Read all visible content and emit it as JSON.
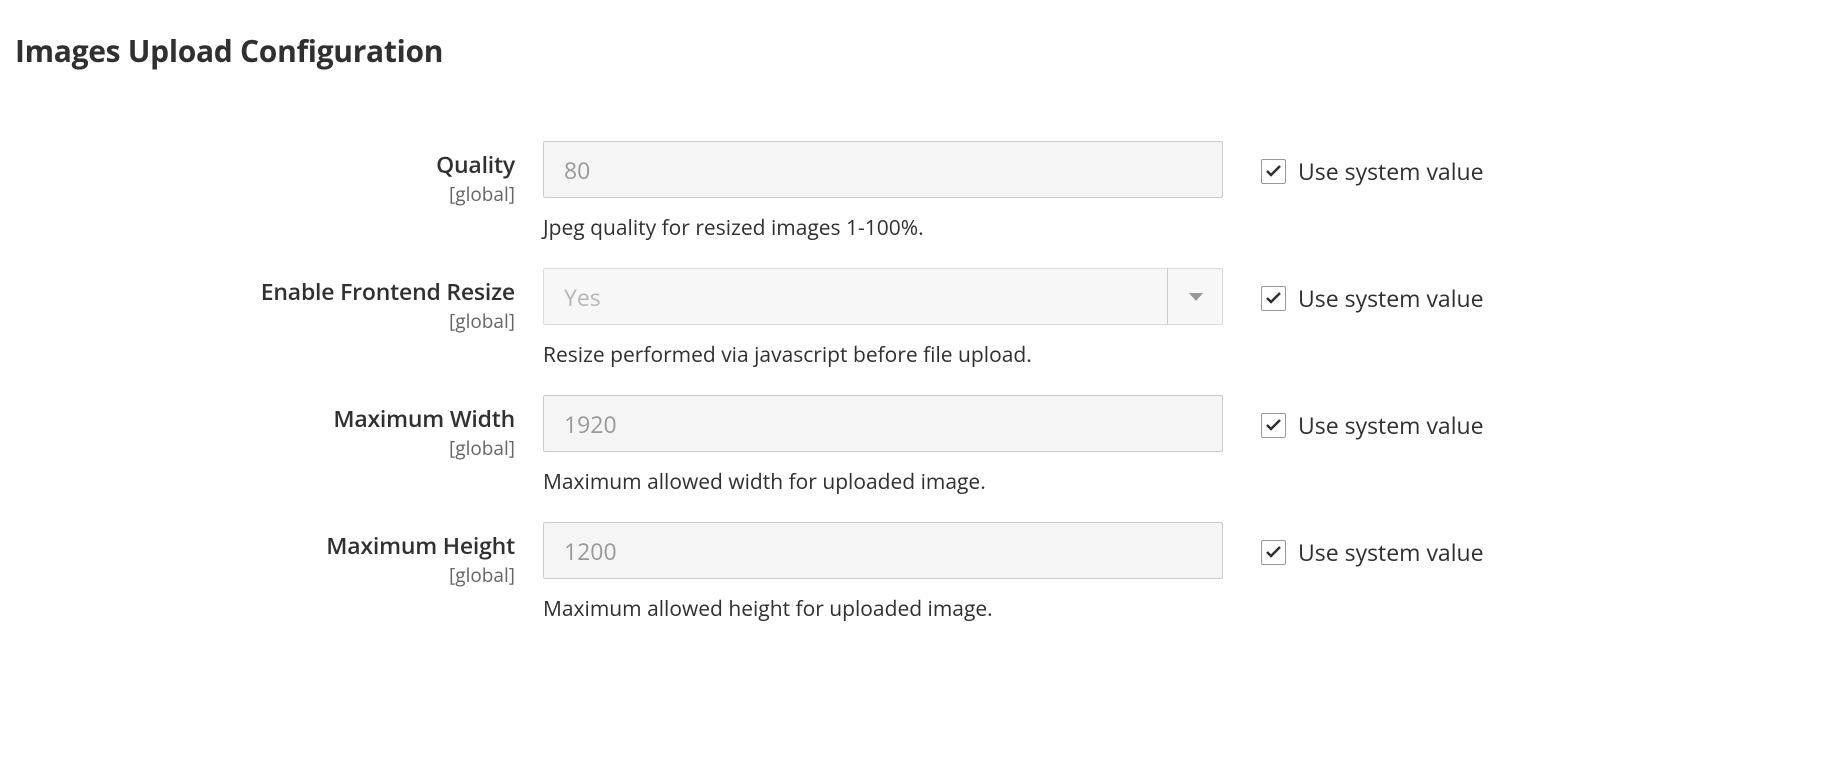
{
  "section": {
    "title": "Images Upload Configuration"
  },
  "common": {
    "scope_label": "[global]",
    "use_system_label": "Use system value"
  },
  "fields": {
    "quality": {
      "label": "Quality",
      "value": "80",
      "help": "Jpeg quality for resized images 1-100%.",
      "use_system": true
    },
    "frontend_resize": {
      "label": "Enable Frontend Resize",
      "value": "Yes",
      "help": "Resize performed via javascript before file upload.",
      "use_system": true
    },
    "max_width": {
      "label": "Maximum Width",
      "value": "1920",
      "help": "Maximum allowed width for uploaded image.",
      "use_system": true
    },
    "max_height": {
      "label": "Maximum Height",
      "value": "1200",
      "help": "Maximum allowed height for uploaded image.",
      "use_system": true
    }
  }
}
